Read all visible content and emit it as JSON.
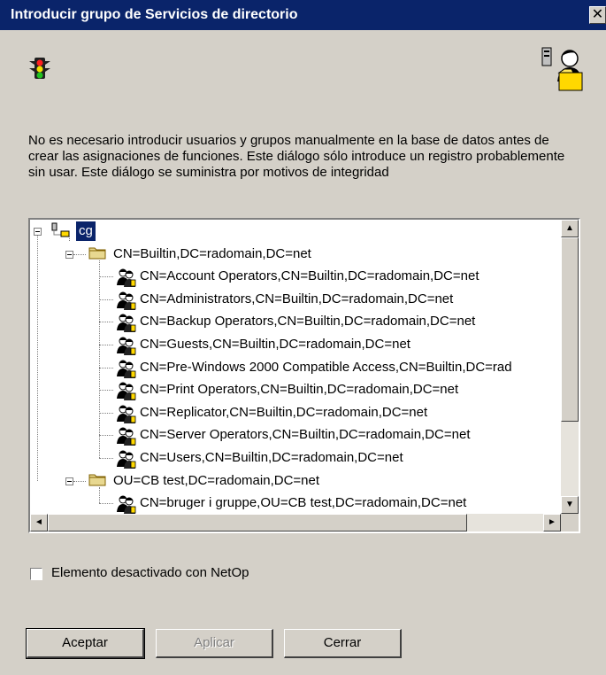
{
  "window": {
    "title": "Introducir grupo de Servicios de directorio",
    "close_glyph": "✕"
  },
  "icons": {
    "traffic_light": "traffic-light-icon",
    "user_folder": "user-folder-icon",
    "tree_root": "network-icon",
    "container": "folder-icon",
    "group": "group-icon"
  },
  "description": "No es necesario introducir usuarios y grupos manualmente en la base de datos antes de crear las asignaciones de funciones. Este diálogo sólo introduce un registro probablemente sin usar. Este diálogo se suministra por motivos de integridad",
  "tree": {
    "root": {
      "label": "cg",
      "selected": true
    },
    "containers": [
      {
        "label": "CN=Builtin,DC=radomain,DC=net",
        "expanded": true,
        "children": [
          "CN=Account Operators,CN=Builtin,DC=radomain,DC=net",
          "CN=Administrators,CN=Builtin,DC=radomain,DC=net",
          "CN=Backup Operators,CN=Builtin,DC=radomain,DC=net",
          "CN=Guests,CN=Builtin,DC=radomain,DC=net",
          "CN=Pre-Windows 2000 Compatible Access,CN=Builtin,DC=rad",
          "CN=Print Operators,CN=Builtin,DC=radomain,DC=net",
          "CN=Replicator,CN=Builtin,DC=radomain,DC=net",
          "CN=Server Operators,CN=Builtin,DC=radomain,DC=net",
          "CN=Users,CN=Builtin,DC=radomain,DC=net"
        ]
      },
      {
        "label": "OU=CB test,DC=radomain,DC=net",
        "expanded": true,
        "children": [
          "CN=bruger i gruppe,OU=CB test,DC=radomain,DC=net"
        ]
      }
    ]
  },
  "scrollbars": {
    "up": "▲",
    "down": "▼",
    "left": "◄",
    "right": "►"
  },
  "checkbox": {
    "label": "Elemento desactivado con NetOp",
    "checked": false
  },
  "buttons": {
    "accept": "Aceptar",
    "apply": "Aplicar",
    "close": "Cerrar"
  },
  "colors": {
    "titlebar": "#0a246a",
    "face": "#d4d0c8",
    "selection": "#0a246a"
  }
}
